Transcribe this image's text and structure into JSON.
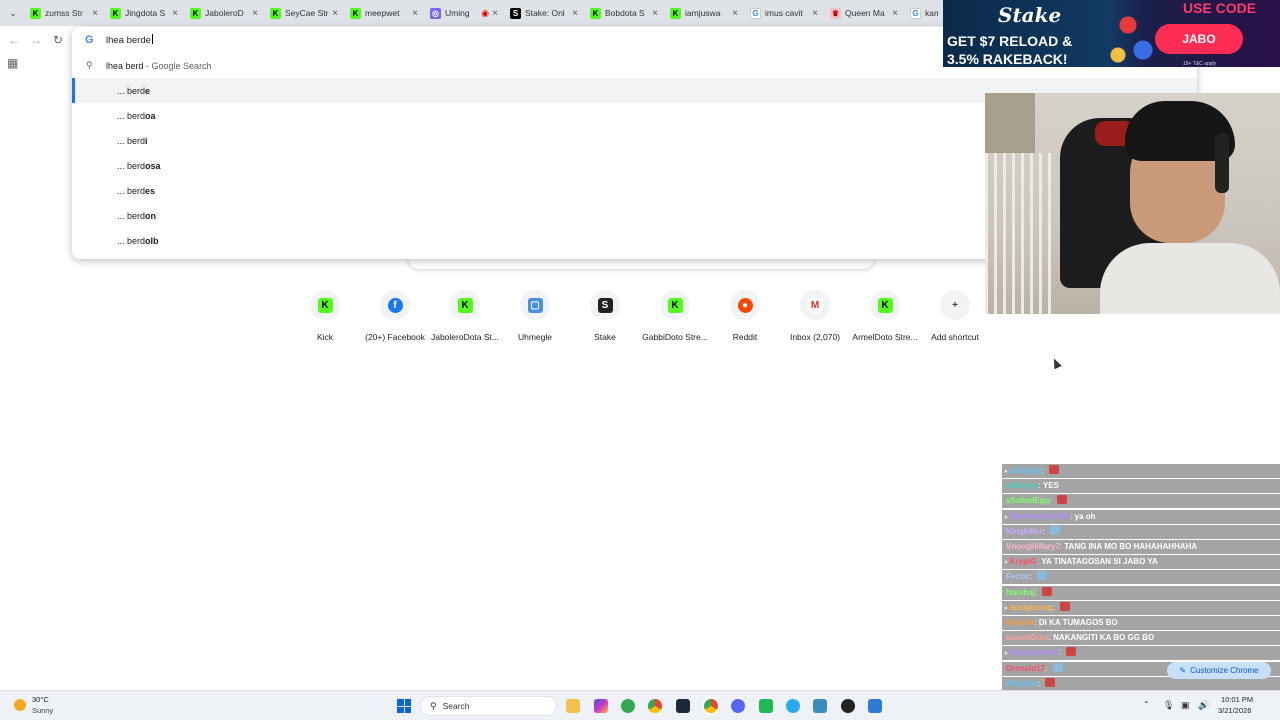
{
  "tabs": [
    {
      "title": "zumss Str",
      "favicon": "kick-icon",
      "active": false
    },
    {
      "title": "Jingdota S",
      "favicon": "kick-icon",
      "active": false
    },
    {
      "title": "JaboleroD",
      "favicon": "kick-icon",
      "active": false
    },
    {
      "title": "SeyCae Str",
      "favicon": "kick-icon",
      "active": false
    },
    {
      "title": "meepwet",
      "favicon": "kick-icon",
      "active": false
    },
    {
      "title": "Uming",
      "favicon": "umingo-icon",
      "active": false
    },
    {
      "title": "Stake: Onl",
      "favicon": "stake-icon",
      "active": false
    },
    {
      "title": "Bobdota S",
      "favicon": "kick-icon",
      "active": false
    },
    {
      "title": "iamjuswa",
      "favicon": "kick-icon",
      "active": false
    },
    {
      "title": "imus cavit",
      "favicon": "google-icon",
      "active": false
    },
    {
      "title": "Queen Ma",
      "favicon": "queen-icon",
      "active": false
    },
    {
      "title": "kama",
      "favicon": "google-icon",
      "active": true
    }
  ],
  "omnibox": {
    "input_value": "lhea berde",
    "rows": [
      {
        "icon": "search-icon",
        "text": "lhea berd",
        "suffix": " - Google Search",
        "selected": false
      },
      {
        "prefix": "... berd",
        "completion": "e",
        "selected": true
      },
      {
        "prefix": "... berd",
        "completion": "oa",
        "selected": false
      },
      {
        "prefix": "... berd",
        "completion": "i",
        "selected": false
      },
      {
        "prefix": "... berd",
        "completion": "osa",
        "selected": false
      },
      {
        "prefix": "... berd",
        "completion": "es",
        "selected": false
      },
      {
        "prefix": "... berd",
        "completion": "on",
        "selected": false
      },
      {
        "prefix": "... berd",
        "completion": "olb",
        "selected": false
      }
    ]
  },
  "shortcuts": [
    {
      "label": "Kick",
      "icon": "kick-icon"
    },
    {
      "label": "(20+) Facebook",
      "icon": "facebook-icon"
    },
    {
      "label": "JaboleroDota St...",
      "icon": "kick-icon"
    },
    {
      "label": "Uhmegle",
      "icon": "uhmegle-icon"
    },
    {
      "label": "Stake",
      "icon": "stake-icon"
    },
    {
      "label": "GabbiDoto Stre...",
      "icon": "kick-icon"
    },
    {
      "label": "Reddit",
      "icon": "reddit-icon"
    },
    {
      "label": "Inbox (2,070)",
      "icon": "gmail-icon"
    },
    {
      "label": "ArmelDoto Stre...",
      "icon": "kick-icon"
    },
    {
      "label": "Add shortcut",
      "icon": "plus-icon"
    }
  ],
  "ad": {
    "logo": "Stake",
    "headline1": "GET $7 RELOAD &",
    "headline2": "3.5% RAKEBACK!",
    "use_code_label": "USE CODE",
    "code": "JABO",
    "fine_print": "18+ T&C apply"
  },
  "chat": [
    {
      "user": "zrfzyzfrz",
      "msg": "",
      "color": "#58c7ff"
    },
    {
      "user": "Izzkyyyy",
      "msg": "YES",
      "color": "#3fd1c4"
    },
    {
      "user": "xSaltedEgg",
      "msg": "",
      "color": "#7cff6b"
    },
    {
      "user": "DarthVader2001",
      "msg": "ya oh",
      "color": "#b48cff"
    },
    {
      "user": "Kingkiller",
      "msg": "",
      "color": "#c9a7ff"
    },
    {
      "user": "VnongHillary7",
      "msg": "TANG INA MO BO HAHAHAHHAHA",
      "color": "#ffb3d1"
    },
    {
      "user": "KryptG",
      "msg": "YA TINATAGOSAN SI JABO YA",
      "color": "#ff4d6d"
    },
    {
      "user": "Fectar",
      "msg": "",
      "color": "#a8c7ff"
    },
    {
      "user": "Nanibaj",
      "msg": "",
      "color": "#7cff6b"
    },
    {
      "user": "Isangtsong",
      "msg": "",
      "color": "#ffb347"
    },
    {
      "user": "Kiwosh",
      "msg": "DI KA TUMAGOS BO",
      "color": "#ff9a3c"
    },
    {
      "user": "IsmaelDota",
      "msg": "NAKANGITI KA BO GG BO",
      "color": "#ffa0a0"
    },
    {
      "user": "Kyukyuwu04",
      "msg": "",
      "color": "#b48cff"
    },
    {
      "user": "Drenold17",
      "msg": "",
      "color": "#ff4d6d"
    },
    {
      "user": "zrfzyzfrz",
      "msg": "",
      "color": "#58c7ff"
    }
  ],
  "customize_chrome_label": "Customize Chrome",
  "taskbar": {
    "weather_temp": "30°C",
    "weather_cond": "Sunny",
    "search_label": "Search",
    "time": "10:01 PM",
    "date": "3/21/2026"
  },
  "colors": {
    "accent": "#1a73e8",
    "kick_green": "#53fc18",
    "ad_pink": "#ff2d55"
  }
}
